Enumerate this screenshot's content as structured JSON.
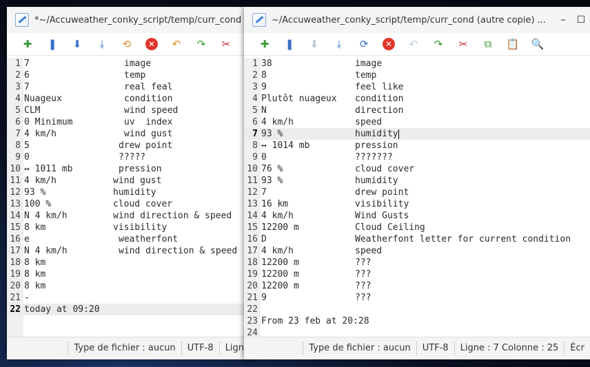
{
  "back_window": {
    "title": "*~/Accuweather_conky_script/temp/curr_cond - M",
    "lines": [
      {
        "n": "1",
        "a": "7",
        "b": "image",
        "bx": 180
      },
      {
        "n": "2",
        "a": "6",
        "b": "temp",
        "bx": 180
      },
      {
        "n": "3",
        "a": "7",
        "b": "real feal",
        "bx": 180
      },
      {
        "n": "4",
        "a": "Nuageux",
        "b": "condition",
        "bx": 180
      },
      {
        "n": "5",
        "a": "CLM",
        "b": "wind speed",
        "bx": 180
      },
      {
        "n": "6",
        "a": "0 Minimum",
        "b": "uv  index",
        "bx": 180
      },
      {
        "n": "7",
        "a": "4 km/h",
        "b": "wind gust",
        "bx": 180
      },
      {
        "n": "8",
        "a": "5",
        "b": "drew point",
        "bx": 172
      },
      {
        "n": "9",
        "a": "0",
        "b": "?????",
        "bx": 172
      },
      {
        "n": "10",
        "a": "↔ 1011 mb",
        "b": "pression",
        "bx": 172
      },
      {
        "n": "11",
        "a": "4 km/h",
        "b": "wind gust",
        "bx": 164
      },
      {
        "n": "12",
        "a": "93 %",
        "b": "humidity",
        "bx": 164
      },
      {
        "n": "13",
        "a": "100 %",
        "b": "cloud cover",
        "bx": 164
      },
      {
        "n": "14",
        "a": "N 4 km/h",
        "b": "wind direction & speed",
        "bx": 164
      },
      {
        "n": "15",
        "a": "8 km",
        "b": "visibility",
        "bx": 164
      },
      {
        "n": "16",
        "a": "e",
        "b": "weatherfont",
        "bx": 172
      },
      {
        "n": "17",
        "a": "N 4 km/h",
        "b": "wind direction & speed",
        "bx": 172
      },
      {
        "n": "18",
        "a": "8 km",
        "b": "",
        "bx": 172
      },
      {
        "n": "19",
        "a": "8 km",
        "b": "",
        "bx": 172
      },
      {
        "n": "20",
        "a": "8 km",
        "b": "",
        "bx": 172
      },
      {
        "n": "21",
        "a": "-",
        "b": "",
        "bx": 172
      },
      {
        "n": "22",
        "a": "today at 09:20",
        "b": "",
        "bx": 172
      }
    ],
    "status": {
      "filetype": "Type de fichier : aucun",
      "encoding": "UTF-8",
      "position": "Ligne"
    }
  },
  "front_window": {
    "title": "~/Accuweather_conky_script/temp/curr_cond (autre copie) ...",
    "minimize": "–",
    "maximize": "☐",
    "lines": [
      {
        "n": "1",
        "a": "38",
        "b": "image"
      },
      {
        "n": "2",
        "a": "8",
        "b": "temp"
      },
      {
        "n": "3",
        "a": "9",
        "b": "feel like"
      },
      {
        "n": "4",
        "a": "Plutôt nuageux",
        "b": "condition"
      },
      {
        "n": "5",
        "a": "N",
        "b": "direction"
      },
      {
        "n": "6",
        "a": "4 km/h",
        "b": "speed"
      },
      {
        "n": "7",
        "a": "93 %",
        "b": "humidity"
      },
      {
        "n": "8",
        "a": "↔ 1014 mb",
        "b": "pression"
      },
      {
        "n": "9",
        "a": "0",
        "b": "???????"
      },
      {
        "n": "10",
        "a": "76 %",
        "b": "cloud cover"
      },
      {
        "n": "11",
        "a": "93 %",
        "b": "humidity"
      },
      {
        "n": "12",
        "a": "7",
        "b": "drew point"
      },
      {
        "n": "13",
        "a": "16 km",
        "b": "visibility"
      },
      {
        "n": "14",
        "a": "4 km/h",
        "b": "Wind Gusts"
      },
      {
        "n": "15",
        "a": "12200 m",
        "b": "Cloud Ceiling"
      },
      {
        "n": "16",
        "a": "D",
        "b": "Weatherfont letter for current condition"
      },
      {
        "n": "17",
        "a": "4 km/h",
        "b": "speed"
      },
      {
        "n": "18",
        "a": "12200 m",
        "b": "???"
      },
      {
        "n": "19",
        "a": "12200 m",
        "b": "???"
      },
      {
        "n": "20",
        "a": "12200 m",
        "b": "???"
      },
      {
        "n": "21",
        "a": "9",
        "b": "???"
      },
      {
        "n": "22",
        "a": "",
        "b": ""
      },
      {
        "n": "23",
        "a": "From 23 feb at 20:28",
        "b": ""
      },
      {
        "n": "24",
        "a": "",
        "b": ""
      }
    ],
    "status": {
      "filetype": "Type de fichier : aucun",
      "encoding": "UTF-8",
      "position": "Ligne : 7 Colonne : 25",
      "extra": "Écr"
    }
  }
}
